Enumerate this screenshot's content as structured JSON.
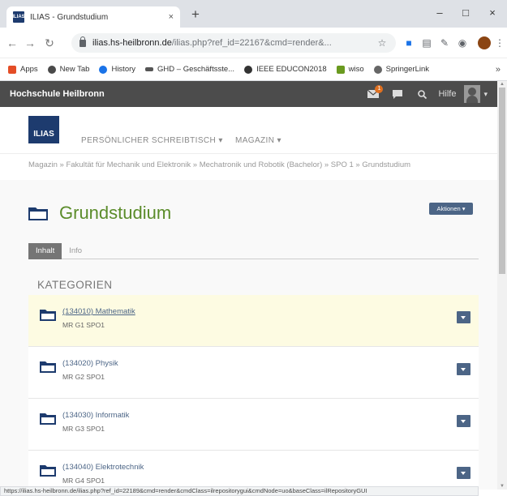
{
  "browser": {
    "tab_title": "ILIAS - Grundstudium",
    "tab_favicon_text": "ILIAS",
    "tab_close": "×",
    "new_tab": "+",
    "window_controls": {
      "minimize": "–",
      "maximize": "□",
      "close": "×"
    },
    "url_host": "ilias.hs-heilbronn.de",
    "url_path": "/ilias.php?ref_id=22167&cmd=render&...",
    "bookmarks": [
      {
        "label": "Apps",
        "color": "#e44d26"
      },
      {
        "label": "New Tab",
        "color": "#4a4a4a"
      },
      {
        "label": "History",
        "color": "#1a73e8"
      },
      {
        "label": "GHD – Geschäftsste...",
        "color": "#555555"
      },
      {
        "label": "IEEE EDUCON2018",
        "color": "#333333"
      },
      {
        "label": "wiso",
        "color": "#6a9a1f"
      },
      {
        "label": "SpringerLink",
        "color": "#666666"
      }
    ],
    "bookmarks_more": "»",
    "status_url": "https://ilias.hs-heilbronn.de/ilias.php?ref_id=22189&cmd=render&cmdClass=ilrepositorygui&cmdNode=uo&baseClass=ilRepositoryGUI"
  },
  "ilias": {
    "brand": "Hochschule Heilbronn",
    "mail_badge": "1",
    "help_label": "Hilfe",
    "logo_text": "ILIAS",
    "nav": [
      {
        "label": "PERSÖNLICHER SCHREIBTISCH ▾"
      },
      {
        "label": "MAGAZIN ▾"
      }
    ],
    "breadcrumb": "Magazin » Fakultät für Mechanik und Elektronik » Mechatronik und Robotik (Bachelor) » SPO 1 » Grundstudium",
    "page_title": "Grundstudium",
    "actions_label": "Aktionen ▾",
    "tabs": [
      {
        "label": "Inhalt",
        "active": true
      },
      {
        "label": "Info",
        "active": false
      }
    ],
    "section_heading": "KATEGORIEN",
    "categories": [
      {
        "title": "(134010) Mathematik",
        "subtitle": "MR G1 SPO1",
        "highlighted": true
      },
      {
        "title": "(134020) Physik",
        "subtitle": "MR G2 SPO1",
        "highlighted": false
      },
      {
        "title": "(134030) Informatik",
        "subtitle": "MR G3 SPO1",
        "highlighted": false
      },
      {
        "title": "(134040) Elektrotechnik",
        "subtitle": "MR G4 SPO1",
        "highlighted": false
      }
    ]
  },
  "colors": {
    "title_green": "#5b8c2a",
    "ilias_blue": "#1d3b6e",
    "action_blue": "#4c6586",
    "header_gray": "#4c4c4c",
    "highlight_row": "#fdfbe2"
  }
}
